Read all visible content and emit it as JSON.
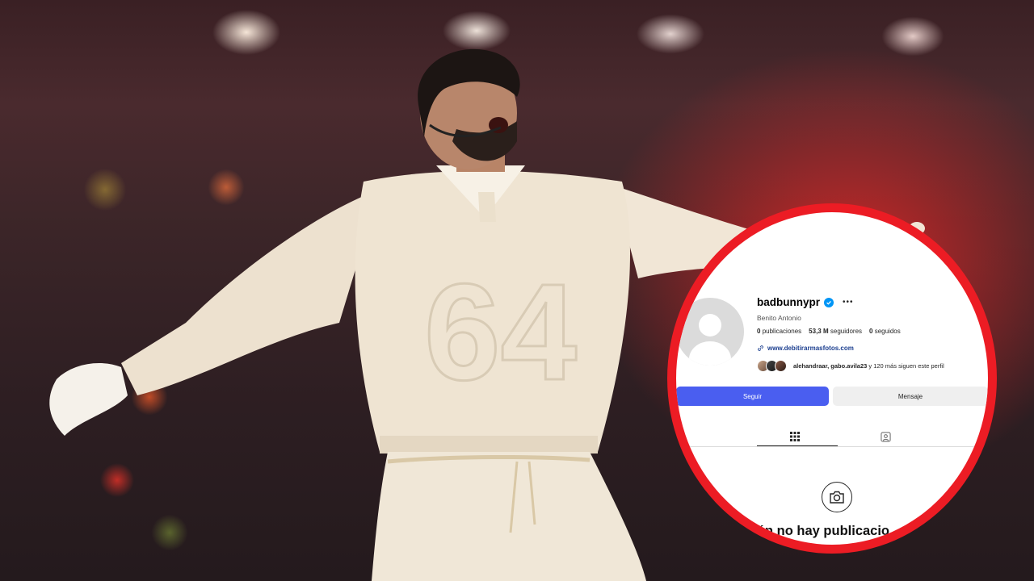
{
  "profile": {
    "username": "badbunnypr",
    "full_name": "Benito Antonio",
    "stats": {
      "posts_count": "0",
      "posts_label": "publicaciones",
      "followers_count": "53,3 M",
      "followers_label": "seguidores",
      "following_count": "0",
      "following_label": "seguidos"
    },
    "link": "www.debitirarmasfotos.com",
    "followed_by_names": "alehandraar, gabo.avila23",
    "followed_by_rest": " y 120 más siguen este perfil"
  },
  "actions": {
    "follow_label": "Seguir",
    "message_label": "Mensaje"
  },
  "empty_state": {
    "title": "Aún no hay publicacio"
  },
  "colors": {
    "ring": "#ec1c24",
    "follow_button": "#4a5ef0",
    "verified": "#0095f6",
    "link": "#1b3e8f"
  },
  "icons": [
    "verified-badge-icon",
    "more-options-icon",
    "link-icon",
    "grid-icon",
    "tagged-icon",
    "camera-icon"
  ]
}
